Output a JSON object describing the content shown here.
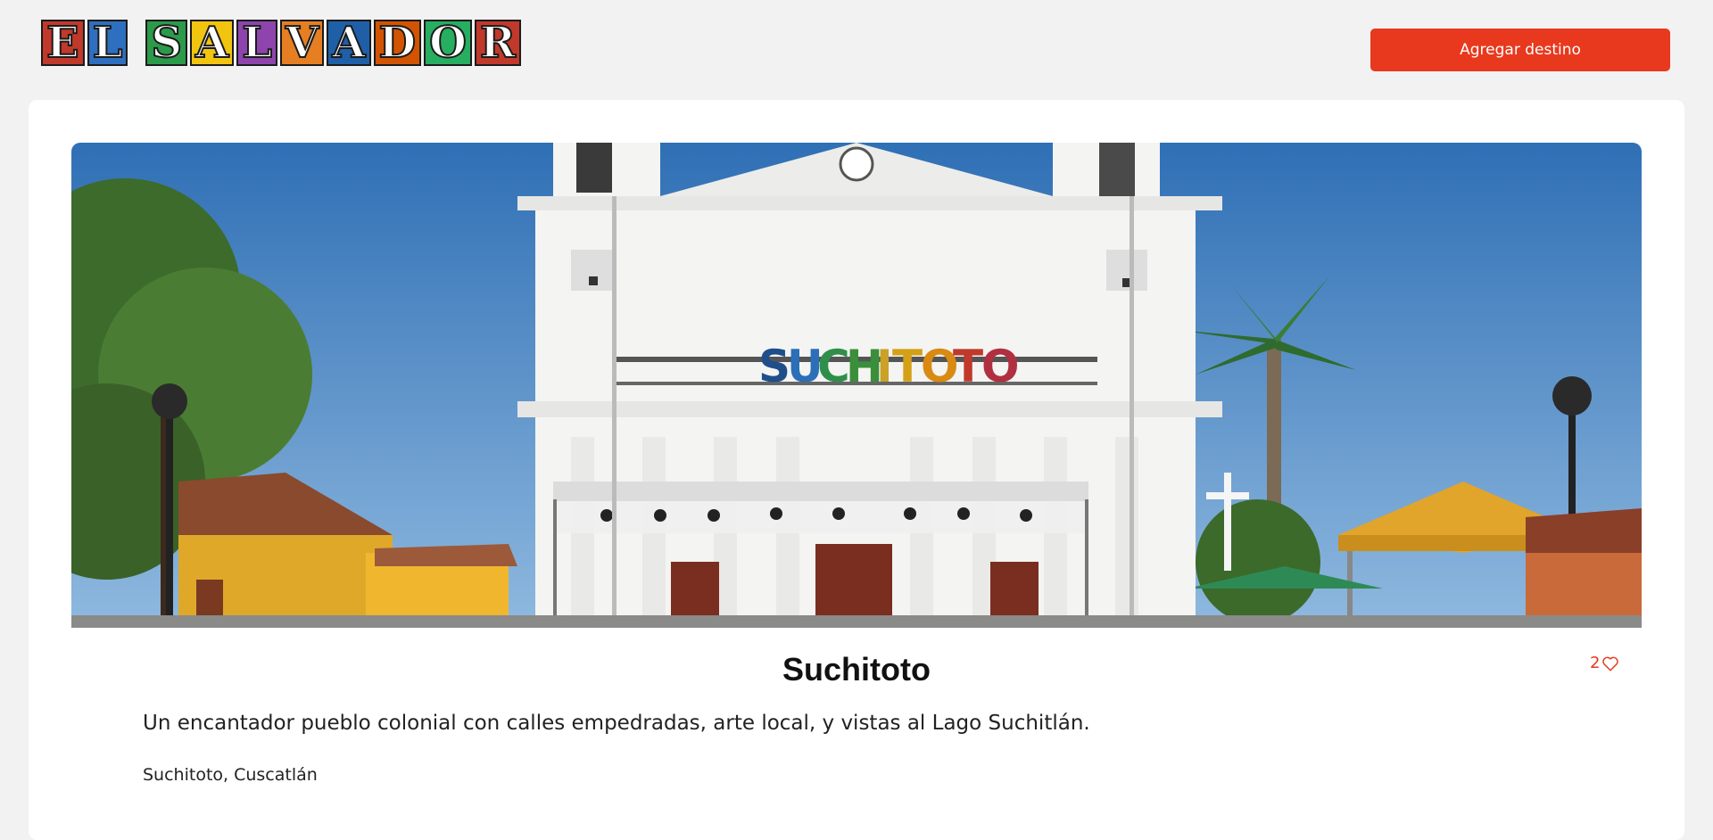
{
  "header": {
    "logo_letters": [
      "E",
      "L",
      "S",
      "A",
      "L",
      "V",
      "A",
      "D",
      "O",
      "R"
    ],
    "add_button_label": "Agregar destino"
  },
  "destination": {
    "title": "Suchitoto",
    "likes": "2",
    "description": "Un encantador pueblo colonial con calles empedradas, arte local, y vistas al Lago Suchitlán.",
    "location": "Suchitoto, Cuscatlán",
    "image_sign_letters": [
      "S",
      "U",
      "C",
      "H",
      "I",
      "T",
      "O",
      "T",
      "O"
    ]
  },
  "colors": {
    "accent": "#e8391e",
    "page_bg": "#f2f2f2",
    "card_bg": "#ffffff",
    "logo_tiles": [
      "#c0392b",
      "#2e6fbf",
      "#2b9a4a",
      "#f1c40f",
      "#8e44ad",
      "#e67e22",
      "#1f5fa8",
      "#d35400",
      "#27ae60",
      "#c0392b"
    ],
    "sign_letters": [
      "#1f4f8b",
      "#2a6fb8",
      "#2f8f4a",
      "#3a8f3a",
      "#c9a227",
      "#d4a017",
      "#d88a12",
      "#c0392b",
      "#b03040"
    ]
  }
}
